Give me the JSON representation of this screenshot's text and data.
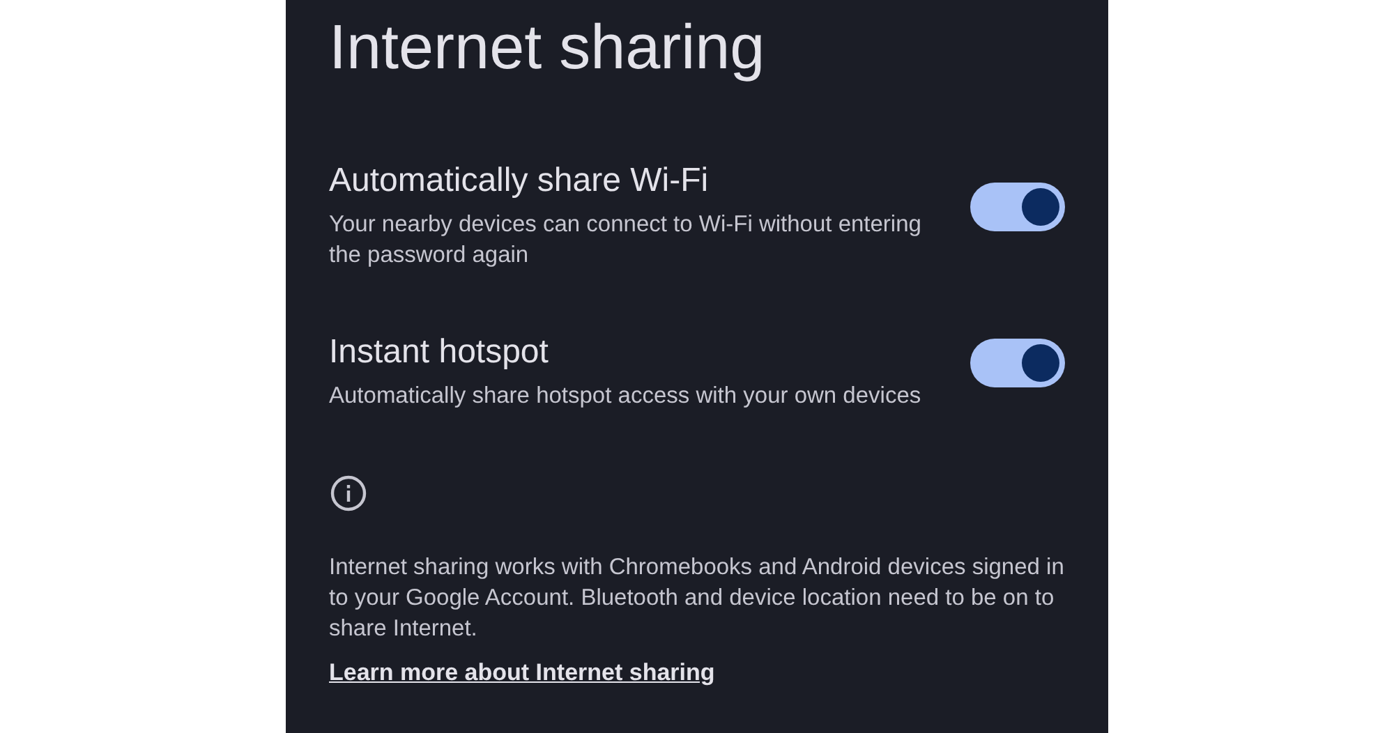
{
  "title": "Internet sharing",
  "settings": [
    {
      "label": "Automatically share Wi-Fi",
      "description": "Your nearby devices can connect to Wi-Fi without entering the password again",
      "on": true
    },
    {
      "label": "Instant hotspot",
      "description": "Automatically share hotspot access with your own devices",
      "on": true
    }
  ],
  "info": {
    "text": "Internet sharing works with Chromebooks and Android devices signed in to your Google Account. Bluetooth and device location need to be on to share Internet.",
    "link": "Learn more about Internet sharing"
  }
}
